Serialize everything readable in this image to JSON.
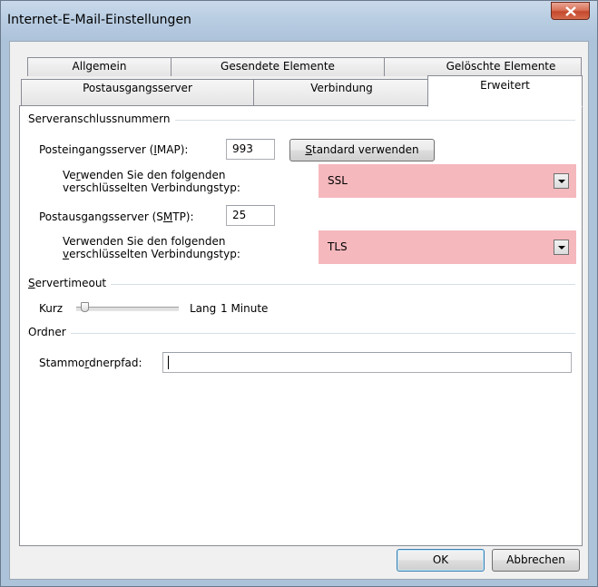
{
  "window": {
    "title": "Internet-E-Mail-Einstellungen"
  },
  "tabs": {
    "row_back": [
      "Allgemein",
      "Gesendete Elemente",
      "Gelöschte Elemente"
    ],
    "row_front": [
      "Postausgangsserver",
      "Verbindung",
      "Erweitert"
    ],
    "active": "Erweitert"
  },
  "ports": {
    "group_label": "Serveranschlussnummern",
    "incoming_label_pre": "Posteingangsserver (",
    "incoming_label_ul": "I",
    "incoming_label_post": "MAP):",
    "incoming_value": "993",
    "default_btn_pre": "S",
    "default_btn_post": "tandard verwenden",
    "enc_label_1_line1_pre": "Ve",
    "enc_label_1_line1_ul": "r",
    "enc_label_1_line1_post": "wenden Sie den folgenden",
    "enc_label_1_line2": "verschlüsselten Verbindungstyp:",
    "incoming_encryption": "SSL",
    "outgoing_label_pre": "Postausgangsserver (S",
    "outgoing_label_ul": "M",
    "outgoing_label_post": "TP):",
    "outgoing_value": "25",
    "enc_label_2_line1": "Verwenden Sie den folgenden",
    "enc_label_2_line2_ul": "v",
    "enc_label_2_line2_post": "erschlüsselten Verbindungstyp:",
    "outgoing_encryption": "TLS"
  },
  "timeout": {
    "group_label_ul": "S",
    "group_label_post": "ervertimeout",
    "short_label": "Kurz",
    "long_label": "Lang",
    "value_text": "1 Minute",
    "level_fraction": 0.05
  },
  "folder": {
    "group_label": "Ordner",
    "root_label_pre": "Stammo",
    "root_label_ul": "r",
    "root_label_post": "dnerpfad:",
    "root_value": ""
  },
  "buttons": {
    "ok": "OK",
    "cancel": "Abbrechen"
  },
  "colors": {
    "highlight": "#f5b8bd",
    "close": "#c4482d"
  }
}
